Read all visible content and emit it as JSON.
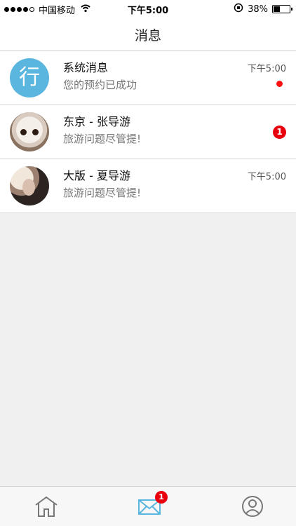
{
  "status_bar": {
    "carrier": "中国移动",
    "time": "下午5:00",
    "battery": "38%",
    "battery_level": 0.38
  },
  "header": {
    "title": "消息"
  },
  "conversations": [
    {
      "avatar_text": "行",
      "name": "系统消息",
      "preview": "您的预约已成功",
      "time": "下午5:00",
      "unread_dot": true
    },
    {
      "name": "东京 - 张导游",
      "preview": "旅游问题尽管提!",
      "time": "",
      "badge": "1"
    },
    {
      "name": "大版 - 夏导游",
      "preview": "旅游问题尽管提!",
      "time": "下午5:00"
    }
  ],
  "tabbar": {
    "items": [
      {
        "icon": "home-icon"
      },
      {
        "icon": "mail-icon",
        "badge": "1"
      },
      {
        "icon": "user-icon"
      }
    ]
  },
  "colors": {
    "accent": "#5ab6df",
    "badge": "#e9000f"
  }
}
